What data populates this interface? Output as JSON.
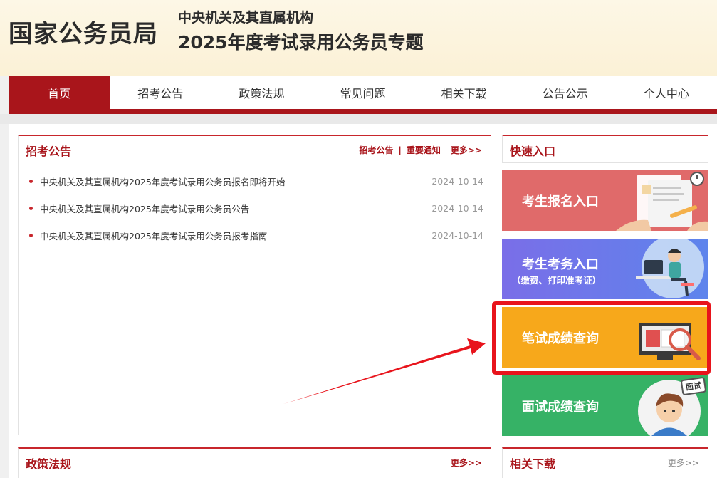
{
  "header": {
    "org_name": "国家公务员局",
    "subtitle_line1": "中央机关及其直属机构",
    "subtitle_line2": "2025年度考试录用公务员专题"
  },
  "nav": {
    "items": [
      {
        "label": "首页",
        "active": true
      },
      {
        "label": "招考公告",
        "active": false
      },
      {
        "label": "政策法规",
        "active": false
      },
      {
        "label": "常见问题",
        "active": false
      },
      {
        "label": "相关下载",
        "active": false
      },
      {
        "label": "公告公示",
        "active": false
      },
      {
        "label": "个人中心",
        "active": false
      }
    ]
  },
  "announcements": {
    "title": "招考公告",
    "link1": "招考公告",
    "separator": "|",
    "link2": "重要通知",
    "more": "更多>>",
    "items": [
      {
        "title": "中央机关及其直属机构2025年度考试录用公务员报名即将开始",
        "date": "2024-10-14"
      },
      {
        "title": "中央机关及其直属机构2025年度考试录用公务员公告",
        "date": "2024-10-14"
      },
      {
        "title": "中央机关及其直属机构2025年度考试录用公务员报考指南",
        "date": "2024-10-14"
      }
    ]
  },
  "quick_entry": {
    "title": "快速入口",
    "tiles": [
      {
        "label": "考生报名入口",
        "sub": "",
        "color": "#e06a6a"
      },
      {
        "label": "考生考务入口",
        "sub": "（缴费、打印准考证）",
        "color": "#6f74e6"
      },
      {
        "label": "笔试成绩查询",
        "sub": "",
        "color": "#f7a81b"
      },
      {
        "label": "面试成绩查询",
        "sub": "",
        "color": "#36b266"
      }
    ],
    "speech_bubble": "面试"
  },
  "policy": {
    "title": "政策法规",
    "more": "更多>>"
  },
  "downloads": {
    "title": "相关下载",
    "more": "更多>>"
  },
  "colors": {
    "brand_red": "#a9151b",
    "highlight": "#e8141c"
  }
}
